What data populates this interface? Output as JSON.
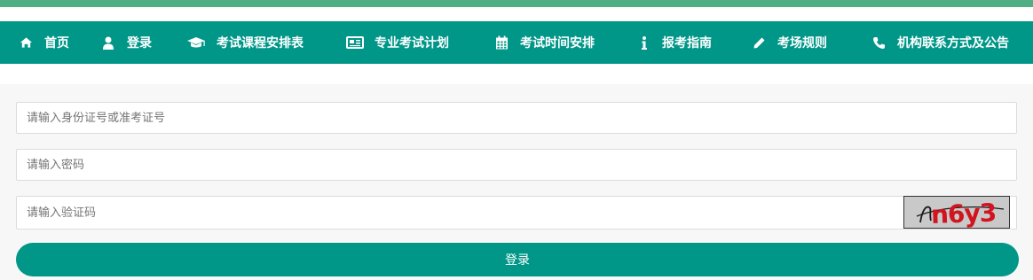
{
  "colors": {
    "accent": "#009688",
    "top_stripe": "#4fae84",
    "captcha_text": "#d2141e"
  },
  "nav": {
    "items": [
      {
        "label": "首页",
        "icon": "home-icon"
      },
      {
        "label": "登录",
        "icon": "user-icon"
      },
      {
        "label": "考试课程安排表",
        "icon": "graduation-cap-icon"
      },
      {
        "label": "专业考试计划",
        "icon": "newspaper-icon"
      },
      {
        "label": "考试时间安排",
        "icon": "calendar-icon"
      },
      {
        "label": "报考指南",
        "icon": "info-icon"
      },
      {
        "label": "考场规则",
        "icon": "pencil-icon"
      },
      {
        "label": "机构联系方式及公告",
        "icon": "phone-icon"
      }
    ]
  },
  "form": {
    "id_placeholder": "请输入身份证号或准考证号",
    "password_placeholder": "请输入密码",
    "captcha_placeholder": "请输入验证码",
    "captcha_text": "n6y3",
    "login_label": "登录"
  }
}
